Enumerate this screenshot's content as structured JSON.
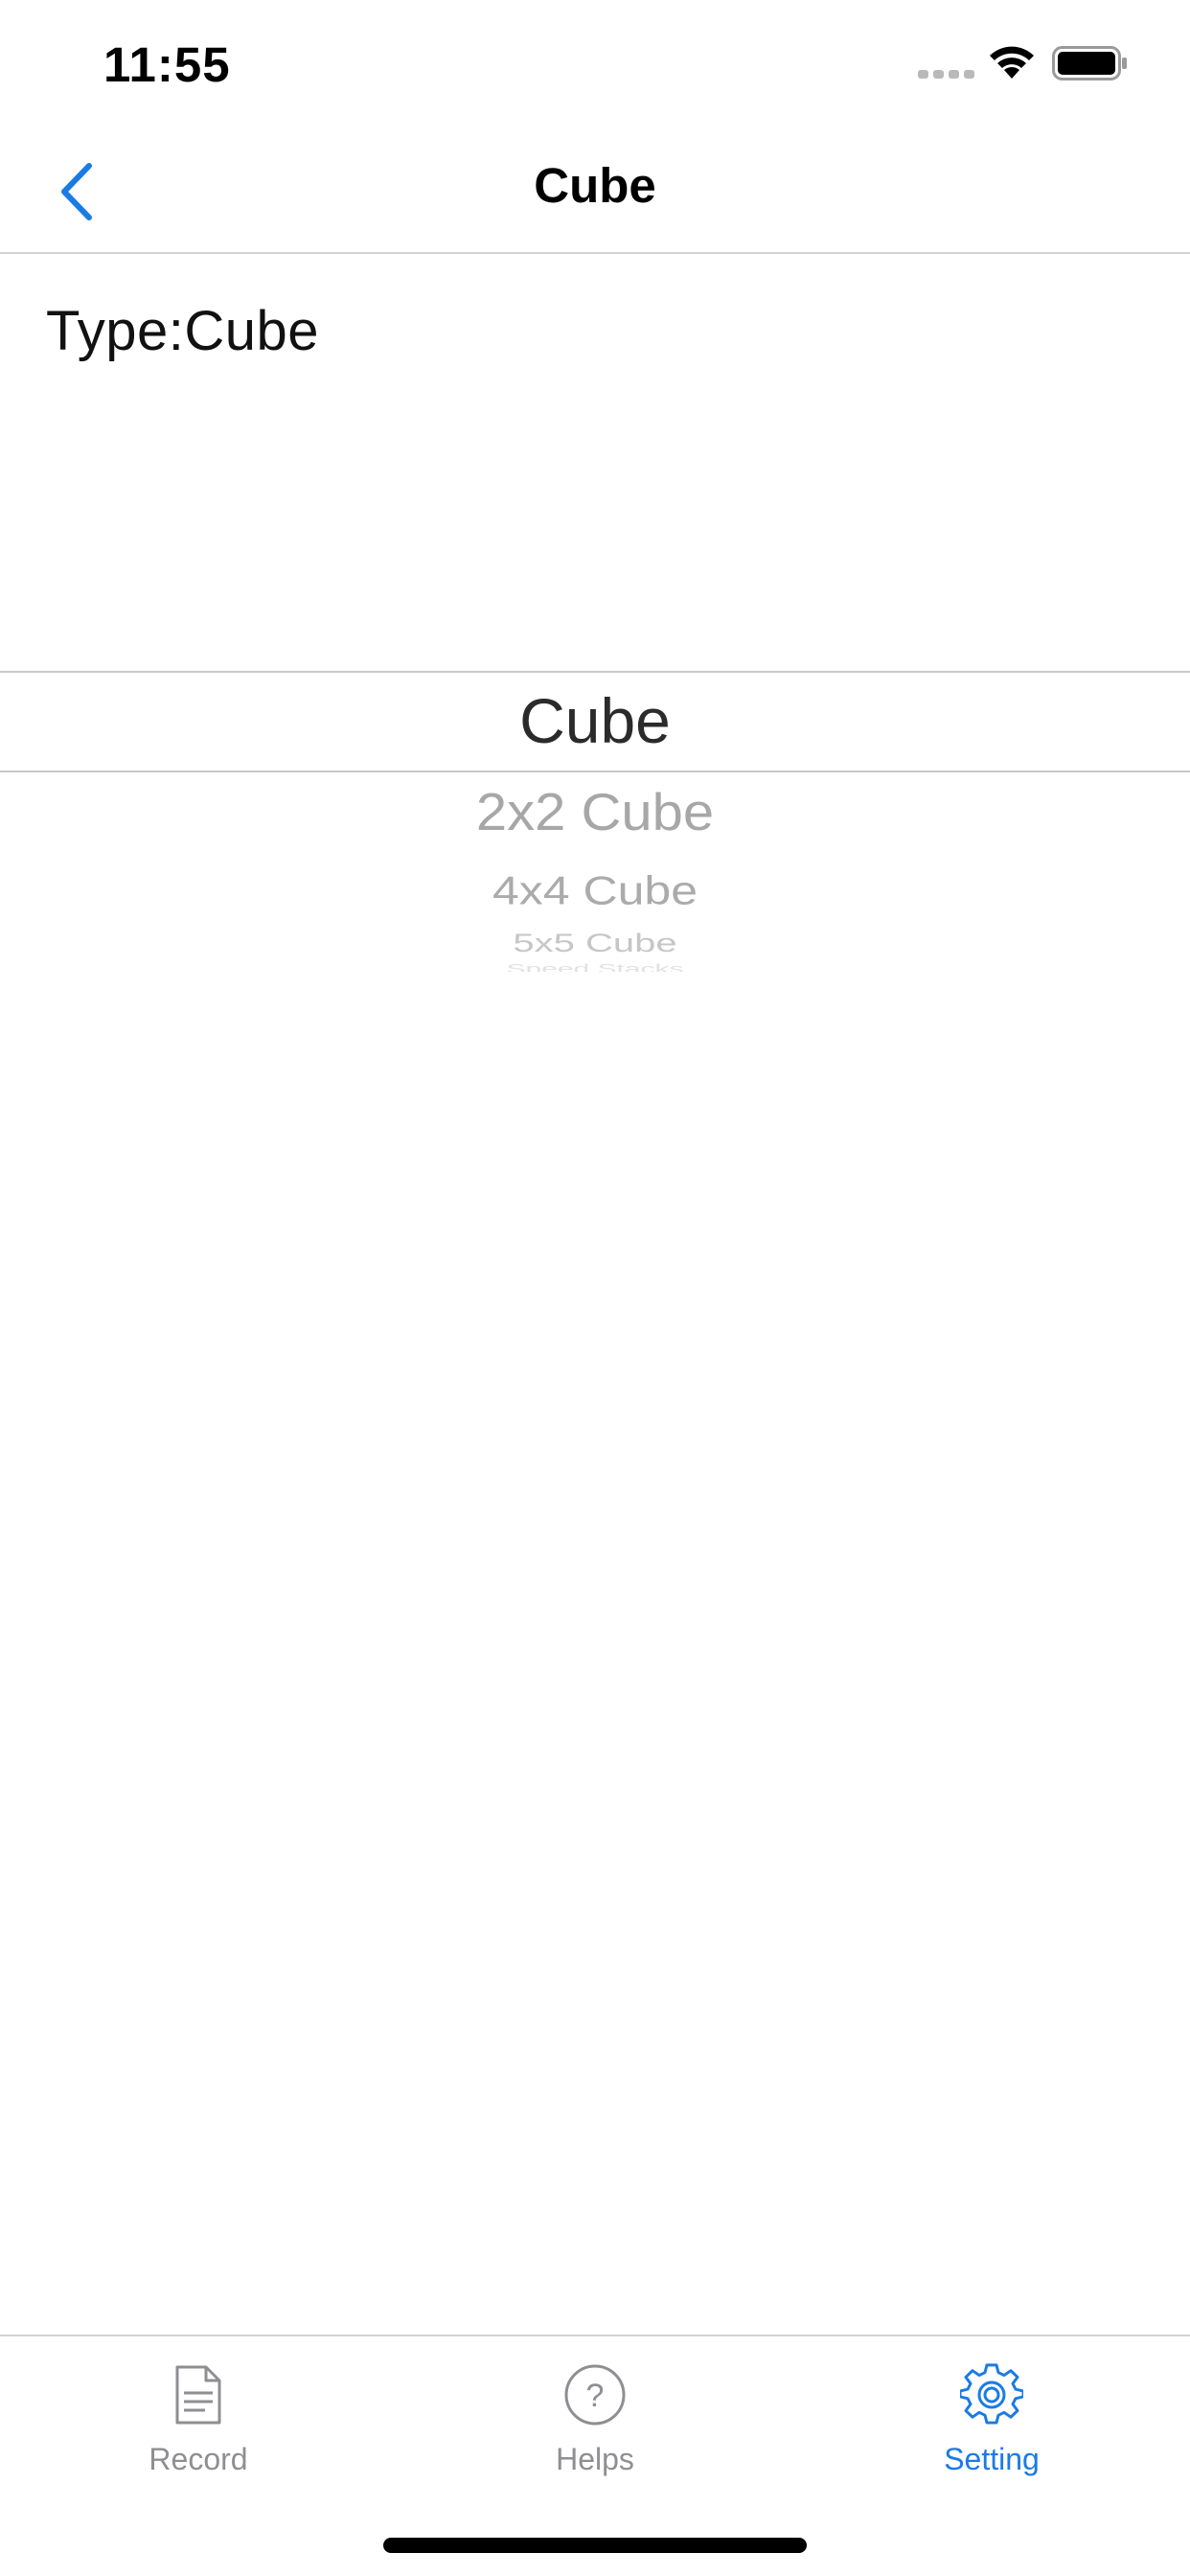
{
  "status_bar": {
    "time": "11:55"
  },
  "nav": {
    "title": "Cube"
  },
  "content": {
    "type_label": "Type:Cube"
  },
  "picker": {
    "selected": "Cube",
    "options_below": [
      "2x2 Cube",
      "4x4 Cube",
      "5x5 Cube",
      "Speed Stacks"
    ]
  },
  "tab_bar": {
    "items": [
      {
        "label": "Record",
        "icon": "document-icon",
        "active": false
      },
      {
        "label": "Helps",
        "icon": "question-circle-icon",
        "active": false
      },
      {
        "label": "Setting",
        "icon": "gear-icon",
        "active": true
      }
    ]
  },
  "colors": {
    "accent": "#1a7be5",
    "inactive": "#8e8e93",
    "separator": "#d2d2d4"
  }
}
